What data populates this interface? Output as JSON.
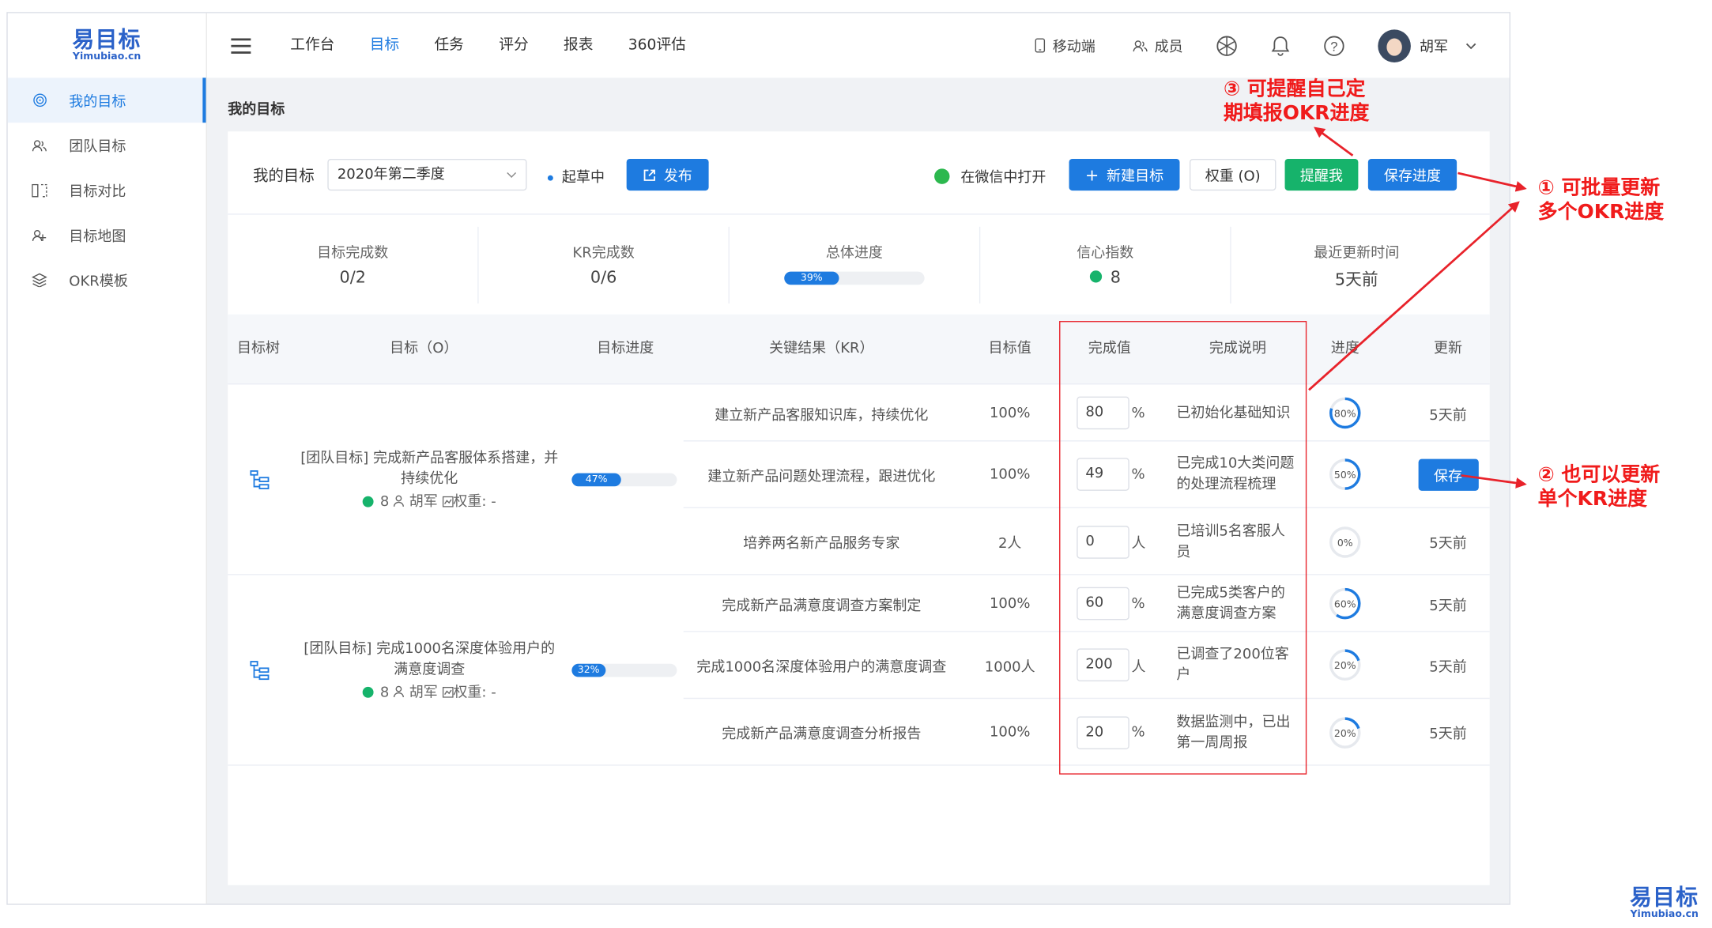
{
  "app": {
    "logo_cn": "易目标",
    "logo_en": "Yimubiao.cn"
  },
  "sidebar": {
    "items": [
      {
        "label": "我的目标",
        "icon": "target-icon",
        "active": true
      },
      {
        "label": "团队目标",
        "icon": "team-icon",
        "active": false
      },
      {
        "label": "目标对比",
        "icon": "compare-icon",
        "active": false
      },
      {
        "label": "目标地图",
        "icon": "map-icon",
        "active": false
      },
      {
        "label": "OKR模板",
        "icon": "layers-icon",
        "active": false
      }
    ]
  },
  "topnav": {
    "items": [
      "工作台",
      "目标",
      "任务",
      "评分",
      "报表",
      "360评估"
    ],
    "active": "目标",
    "mobile": "移动端",
    "members": "成员",
    "user": "胡军"
  },
  "breadcrumb": "我的目标",
  "toolbar": {
    "title": "我的目标",
    "period": "2020年第二季度",
    "status": "起草中",
    "publish": "发布",
    "wechat": "在微信中打开",
    "new_goal": "新建目标",
    "weight": "权重 (O)",
    "remind": "提醒我",
    "save_progress": "保存进度"
  },
  "stats": {
    "goals_done_label": "目标完成数",
    "goals_done": "0/2",
    "kr_done_label": "KR完成数",
    "kr_done": "0/6",
    "total_label": "总体进度",
    "total_pct": 39,
    "total_text": "39%",
    "confidence_label": "信心指数",
    "confidence": "8",
    "updated_label": "最近更新时间",
    "updated": "5天前"
  },
  "table": {
    "headers": {
      "tree": "目标树",
      "objective": "目标（O）",
      "obj_progress": "目标进度",
      "kr": "关键结果（KR）",
      "target": "目标值",
      "done": "完成值",
      "desc": "完成说明",
      "progress": "进度",
      "update": "更新"
    },
    "groups": [
      {
        "objective": "[团队目标] 完成新产品客服体系搭建，并持续优化",
        "confidence": "8",
        "owner": "胡军",
        "weight": "权重: -",
        "progress": 47,
        "progress_text": "47%",
        "krs": [
          {
            "name": "建立新产品客服知识库，持续优化",
            "target": "100%",
            "value": "80",
            "unit": "%",
            "desc": "已初始化基础知识",
            "pct": 80,
            "pct_text": "80%",
            "update": "5天前",
            "save": false
          },
          {
            "name": "建立新产品问题处理流程，跟进优化",
            "target": "100%",
            "value": "49",
            "unit": "%",
            "desc": "已完成10大类问题的处理流程梳理",
            "pct": 50,
            "pct_text": "50%",
            "update": "保存",
            "save": true
          },
          {
            "name": "培养两名新产品服务专家",
            "target": "2人",
            "value": "0",
            "unit": "人",
            "desc": "已培训5名客服人员",
            "pct": 0,
            "pct_text": "0%",
            "update": "5天前",
            "save": false
          }
        ]
      },
      {
        "objective": "[团队目标] 完成1000名深度体验用户的满意度调查",
        "confidence": "8",
        "owner": "胡军",
        "weight": "权重: -",
        "progress": 32,
        "progress_text": "32%",
        "krs": [
          {
            "name": "完成新产品满意度调查方案制定",
            "target": "100%",
            "value": "60",
            "unit": "%",
            "desc": "已完成5类客户的满意度调查方案",
            "pct": 60,
            "pct_text": "60%",
            "update": "5天前",
            "save": false
          },
          {
            "name": "完成1000名深度体验用户的满意度调查",
            "target": "1000人",
            "value": "200",
            "unit": "人",
            "desc": "已调查了200位客户",
            "pct": 20,
            "pct_text": "20%",
            "update": "5天前",
            "save": false
          },
          {
            "name": "完成新产品满意度调查分析报告",
            "target": "100%",
            "value": "20",
            "unit": "%",
            "desc": "数据监测中，已出第一周周报",
            "pct": 20,
            "pct_text": "20%",
            "update": "5天前",
            "save": false
          }
        ]
      }
    ]
  },
  "annotations": {
    "a1_line1": "① 可批量更新",
    "a1_line2": "多个OKR进度",
    "a2_line1": "② 也可以更新",
    "a2_line2": "单个KR进度",
    "a3_line1": "③ 可提醒自己定",
    "a3_line2": "期填报OKR进度",
    "color": "#f01b1b"
  },
  "watermark": {
    "cn": "易目标",
    "en": "Yimubiao.cn"
  },
  "colors": {
    "accent": "#1e7be0",
    "green": "#16b36b",
    "red": "#e8222a"
  }
}
